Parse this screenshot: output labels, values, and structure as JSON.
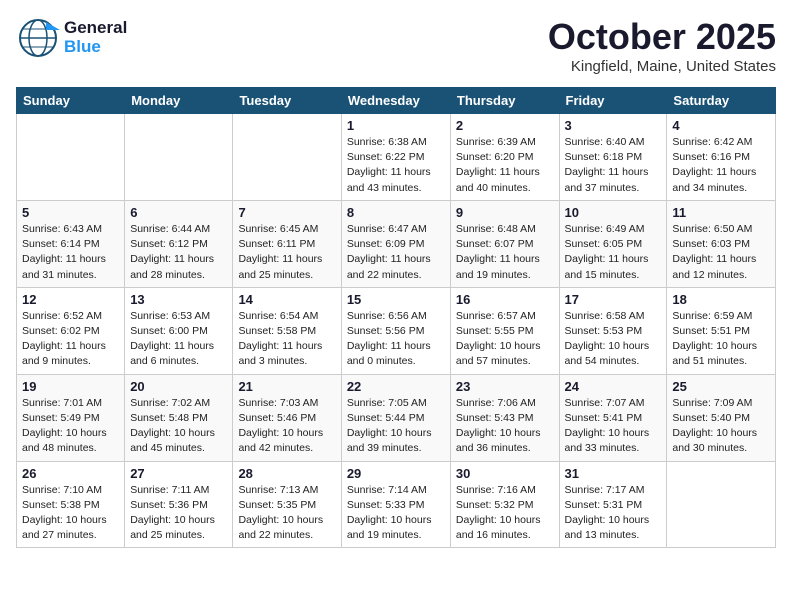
{
  "header": {
    "logo_line1": "General",
    "logo_line2": "Blue",
    "month_title": "October 2025",
    "location": "Kingfield, Maine, United States"
  },
  "weekdays": [
    "Sunday",
    "Monday",
    "Tuesday",
    "Wednesday",
    "Thursday",
    "Friday",
    "Saturday"
  ],
  "weeks": [
    [
      {
        "day": "",
        "info": ""
      },
      {
        "day": "",
        "info": ""
      },
      {
        "day": "",
        "info": ""
      },
      {
        "day": "1",
        "info": "Sunrise: 6:38 AM\nSunset: 6:22 PM\nDaylight: 11 hours\nand 43 minutes."
      },
      {
        "day": "2",
        "info": "Sunrise: 6:39 AM\nSunset: 6:20 PM\nDaylight: 11 hours\nand 40 minutes."
      },
      {
        "day": "3",
        "info": "Sunrise: 6:40 AM\nSunset: 6:18 PM\nDaylight: 11 hours\nand 37 minutes."
      },
      {
        "day": "4",
        "info": "Sunrise: 6:42 AM\nSunset: 6:16 PM\nDaylight: 11 hours\nand 34 minutes."
      }
    ],
    [
      {
        "day": "5",
        "info": "Sunrise: 6:43 AM\nSunset: 6:14 PM\nDaylight: 11 hours\nand 31 minutes."
      },
      {
        "day": "6",
        "info": "Sunrise: 6:44 AM\nSunset: 6:12 PM\nDaylight: 11 hours\nand 28 minutes."
      },
      {
        "day": "7",
        "info": "Sunrise: 6:45 AM\nSunset: 6:11 PM\nDaylight: 11 hours\nand 25 minutes."
      },
      {
        "day": "8",
        "info": "Sunrise: 6:47 AM\nSunset: 6:09 PM\nDaylight: 11 hours\nand 22 minutes."
      },
      {
        "day": "9",
        "info": "Sunrise: 6:48 AM\nSunset: 6:07 PM\nDaylight: 11 hours\nand 19 minutes."
      },
      {
        "day": "10",
        "info": "Sunrise: 6:49 AM\nSunset: 6:05 PM\nDaylight: 11 hours\nand 15 minutes."
      },
      {
        "day": "11",
        "info": "Sunrise: 6:50 AM\nSunset: 6:03 PM\nDaylight: 11 hours\nand 12 minutes."
      }
    ],
    [
      {
        "day": "12",
        "info": "Sunrise: 6:52 AM\nSunset: 6:02 PM\nDaylight: 11 hours\nand 9 minutes."
      },
      {
        "day": "13",
        "info": "Sunrise: 6:53 AM\nSunset: 6:00 PM\nDaylight: 11 hours\nand 6 minutes."
      },
      {
        "day": "14",
        "info": "Sunrise: 6:54 AM\nSunset: 5:58 PM\nDaylight: 11 hours\nand 3 minutes."
      },
      {
        "day": "15",
        "info": "Sunrise: 6:56 AM\nSunset: 5:56 PM\nDaylight: 11 hours\nand 0 minutes."
      },
      {
        "day": "16",
        "info": "Sunrise: 6:57 AM\nSunset: 5:55 PM\nDaylight: 10 hours\nand 57 minutes."
      },
      {
        "day": "17",
        "info": "Sunrise: 6:58 AM\nSunset: 5:53 PM\nDaylight: 10 hours\nand 54 minutes."
      },
      {
        "day": "18",
        "info": "Sunrise: 6:59 AM\nSunset: 5:51 PM\nDaylight: 10 hours\nand 51 minutes."
      }
    ],
    [
      {
        "day": "19",
        "info": "Sunrise: 7:01 AM\nSunset: 5:49 PM\nDaylight: 10 hours\nand 48 minutes."
      },
      {
        "day": "20",
        "info": "Sunrise: 7:02 AM\nSunset: 5:48 PM\nDaylight: 10 hours\nand 45 minutes."
      },
      {
        "day": "21",
        "info": "Sunrise: 7:03 AM\nSunset: 5:46 PM\nDaylight: 10 hours\nand 42 minutes."
      },
      {
        "day": "22",
        "info": "Sunrise: 7:05 AM\nSunset: 5:44 PM\nDaylight: 10 hours\nand 39 minutes."
      },
      {
        "day": "23",
        "info": "Sunrise: 7:06 AM\nSunset: 5:43 PM\nDaylight: 10 hours\nand 36 minutes."
      },
      {
        "day": "24",
        "info": "Sunrise: 7:07 AM\nSunset: 5:41 PM\nDaylight: 10 hours\nand 33 minutes."
      },
      {
        "day": "25",
        "info": "Sunrise: 7:09 AM\nSunset: 5:40 PM\nDaylight: 10 hours\nand 30 minutes."
      }
    ],
    [
      {
        "day": "26",
        "info": "Sunrise: 7:10 AM\nSunset: 5:38 PM\nDaylight: 10 hours\nand 27 minutes."
      },
      {
        "day": "27",
        "info": "Sunrise: 7:11 AM\nSunset: 5:36 PM\nDaylight: 10 hours\nand 25 minutes."
      },
      {
        "day": "28",
        "info": "Sunrise: 7:13 AM\nSunset: 5:35 PM\nDaylight: 10 hours\nand 22 minutes."
      },
      {
        "day": "29",
        "info": "Sunrise: 7:14 AM\nSunset: 5:33 PM\nDaylight: 10 hours\nand 19 minutes."
      },
      {
        "day": "30",
        "info": "Sunrise: 7:16 AM\nSunset: 5:32 PM\nDaylight: 10 hours\nand 16 minutes."
      },
      {
        "day": "31",
        "info": "Sunrise: 7:17 AM\nSunset: 5:31 PM\nDaylight: 10 hours\nand 13 minutes."
      },
      {
        "day": "",
        "info": ""
      }
    ]
  ]
}
